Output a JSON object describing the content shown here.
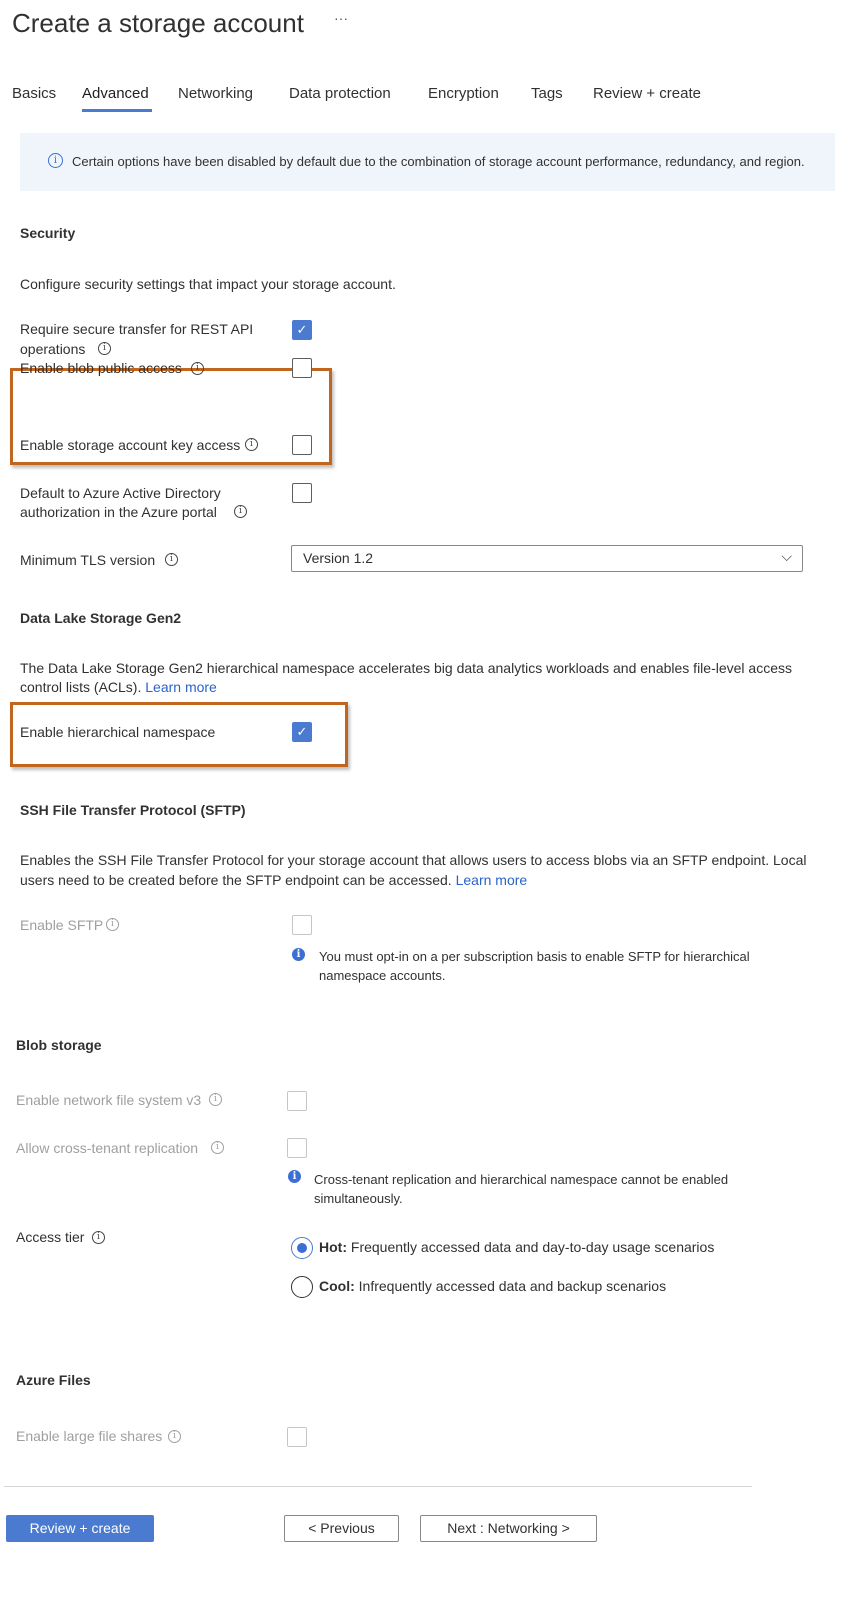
{
  "header": {
    "title": "Create a storage account",
    "more": "···"
  },
  "tabs": [
    {
      "label": "Basics"
    },
    {
      "label": "Advanced",
      "active": true
    },
    {
      "label": "Networking"
    },
    {
      "label": "Data protection"
    },
    {
      "label": "Encryption"
    },
    {
      "label": "Tags"
    },
    {
      "label": "Review + create"
    }
  ],
  "banner": {
    "text": "Certain options have been disabled by default due to the combination of storage account performance, redundancy, and region."
  },
  "security": {
    "heading": "Security",
    "description": "Configure security settings that impact your storage account.",
    "secure_transfer": {
      "label1": "Require secure transfer for REST API",
      "label2": "operations",
      "checked": true
    },
    "blob_public": {
      "label": "Enable blob public access",
      "checked": false
    },
    "key_access": {
      "label": "Enable storage account key access",
      "checked": false
    },
    "aad_default": {
      "label1": "Default to Azure Active Directory",
      "label2": "authorization in the Azure portal",
      "checked": false
    },
    "tls": {
      "label": "Minimum TLS version",
      "value": "Version 1.2"
    }
  },
  "datalake": {
    "heading": "Data Lake Storage Gen2",
    "description1": "The Data Lake Storage Gen2 hierarchical namespace accelerates big data analytics workloads and enables file-level access",
    "description2": "control lists (ACLs).",
    "learn_more": "Learn more",
    "hns": {
      "label": "Enable hierarchical namespace",
      "checked": true
    }
  },
  "sftp": {
    "heading": "SSH File Transfer Protocol (SFTP)",
    "description1": "Enables the SSH File Transfer Protocol for your storage account that allows users to access blobs via an SFTP endpoint. Local",
    "description2": "users need to be created before the SFTP endpoint can be accessed.",
    "learn_more": "Learn more",
    "enable": {
      "label": "Enable SFTP",
      "checked": false,
      "disabled": true
    },
    "note1": "You must opt-in on a per subscription basis to enable SFTP for hierarchical",
    "note2": "namespace accounts."
  },
  "blob": {
    "heading": "Blob storage",
    "nfs": {
      "label": "Enable network file system v3",
      "checked": false,
      "disabled": true
    },
    "cross_tenant": {
      "label": "Allow cross-tenant replication",
      "checked": false,
      "disabled": true
    },
    "note1": "Cross-tenant replication and hierarchical namespace cannot be enabled",
    "note2": "simultaneously.",
    "access_tier": {
      "label": "Access tier",
      "options": [
        {
          "name": "Hot:",
          "desc": "Frequently accessed data and day-to-day usage scenarios",
          "selected": true
        },
        {
          "name": "Cool:",
          "desc": "Infrequently accessed data and backup scenarios",
          "selected": false
        }
      ]
    }
  },
  "files": {
    "heading": "Azure Files",
    "large_shares": {
      "label": "Enable large file shares",
      "checked": false,
      "disabled": true
    }
  },
  "footer": {
    "review": "Review + create",
    "previous": "< Previous",
    "next": "Next : Networking >"
  },
  "colors": {
    "accent": "#4a7bd0",
    "highlight": "#c0661e",
    "banner_bg": "#f0f5fc"
  }
}
